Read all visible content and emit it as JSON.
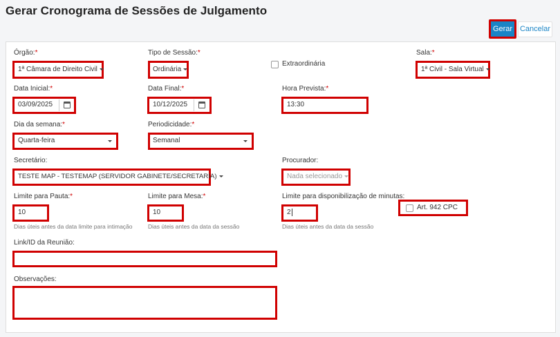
{
  "title": "Gerar Cronograma de Sessões de Julgamento",
  "buttons": {
    "gerar": "Gerar",
    "cancelar": "Cancelar"
  },
  "form": {
    "orgao": {
      "label": "Órgão:",
      "value": "1ª Câmara de Direito Civil"
    },
    "tipo_sessao": {
      "label": "Tipo de Sessão:",
      "value": "Ordinária"
    },
    "extraordinaria": {
      "label": "Extraordinária"
    },
    "sala": {
      "label": "Sala:",
      "value": "1ª Civil - Sala Virtual"
    },
    "data_inicial": {
      "label": "Data Inicial:",
      "value": "03/09/2025"
    },
    "data_final": {
      "label": "Data Final:",
      "value": "10/12/2025"
    },
    "hora_prevista": {
      "label": "Hora Prevista:",
      "value": "13:30"
    },
    "dia_semana": {
      "label": "Dia da semana:",
      "value": "Quarta-feira"
    },
    "periodicidade": {
      "label": "Periodicidade:",
      "value": "Semanal"
    },
    "secretario": {
      "label": "Secretário:",
      "value": "TESTE MAP - TESTEMAP (SERVIDOR GABINETE/SECRETARIA)"
    },
    "procurador": {
      "label": "Procurador:",
      "placeholder": "Nada selecionado"
    },
    "limite_pauta": {
      "label": "Limite para Pauta:",
      "value": "10",
      "help": "Dias úteis antes da data limite para intimação"
    },
    "limite_mesa": {
      "label": "Limite para Mesa:",
      "value": "10",
      "help": "Dias úteis antes da data da sessão"
    },
    "limite_minutas": {
      "label": "Limite para disponibilização de minutas:",
      "value": "2",
      "help": "Dias úteis antes da data da sessão"
    },
    "art942": {
      "label": "Art. 942 CPC"
    },
    "link_reuniao": {
      "label": "Link/ID da Reunião:",
      "value": ""
    },
    "observacoes": {
      "label": "Observações:",
      "value": ""
    }
  },
  "required_mark": "*",
  "colors": {
    "primary": "#1a84c6",
    "highlight": "#d00000",
    "required": "#d00000"
  },
  "icons": {
    "calendar": "calendar-icon",
    "dropdown": "caret-down-icon"
  }
}
